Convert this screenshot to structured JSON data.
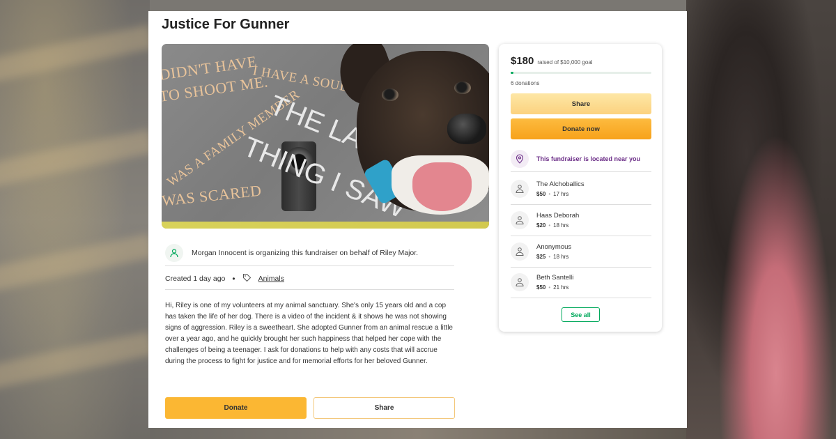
{
  "page": {
    "title": "Justice For Gunner",
    "hero_image": {
      "phrases": [
        "DIDN'T HAVE",
        "TO SHOOT ME.",
        "I HAVE A SOUL",
        "WAS A FAMILY MEMBER",
        "WAS SCARED"
      ],
      "headline_line1": "THE LAST",
      "headline_line2": "THING I SAW"
    },
    "organizer": {
      "text": "Morgan Innocent is organizing this fundraiser on behalf of Riley Major.",
      "icon": "organizer-person-icon"
    },
    "meta": {
      "created": "Created 1 day ago",
      "separator": "•",
      "category": "Animals",
      "category_icon": "tag-icon"
    },
    "story": "Hi, Riley is one of my volunteers at my animal sanctuary. She's only 15 years old and a cop has taken the life of her dog. There is a video of the incident & it shows he was not showing signs of aggression. Riley is a sweetheart. She adopted Gunner from an animal rescue a little over a year ago, and he quickly brought her such happiness that helped her cope with the challenges of being a teenager. I ask for donations to help with any costs that will accrue during the process to fight for justice and for memorial efforts for her beloved Gunner.",
    "buttons": {
      "donate": "Donate",
      "share": "Share"
    }
  },
  "sidebar": {
    "raised_amount": "$180",
    "goal_text": "raised of $10,000 goal",
    "progress_fraction": 0.018,
    "donations_count": "6 donations",
    "share_label": "Share",
    "donate_label": "Donate now",
    "location_text": "This fundraiser is located near you",
    "location_icon": "location-pin-icon",
    "donors": [
      {
        "name": "The Alchoballics",
        "amount": "$50",
        "time": "17 hrs"
      },
      {
        "name": "Haas Deborah",
        "amount": "$20",
        "time": "18 hrs"
      },
      {
        "name": "Anonymous",
        "amount": "$25",
        "time": "18 hrs"
      },
      {
        "name": "Beth Santelli",
        "amount": "$50",
        "time": "21 hrs"
      }
    ],
    "donor_icon": "donor-hand-icon",
    "see_all_label": "See all"
  },
  "colors": {
    "accent_green": "#02a95c",
    "donate_orange": "#fbb733",
    "location_purple": "#6b2d87"
  }
}
